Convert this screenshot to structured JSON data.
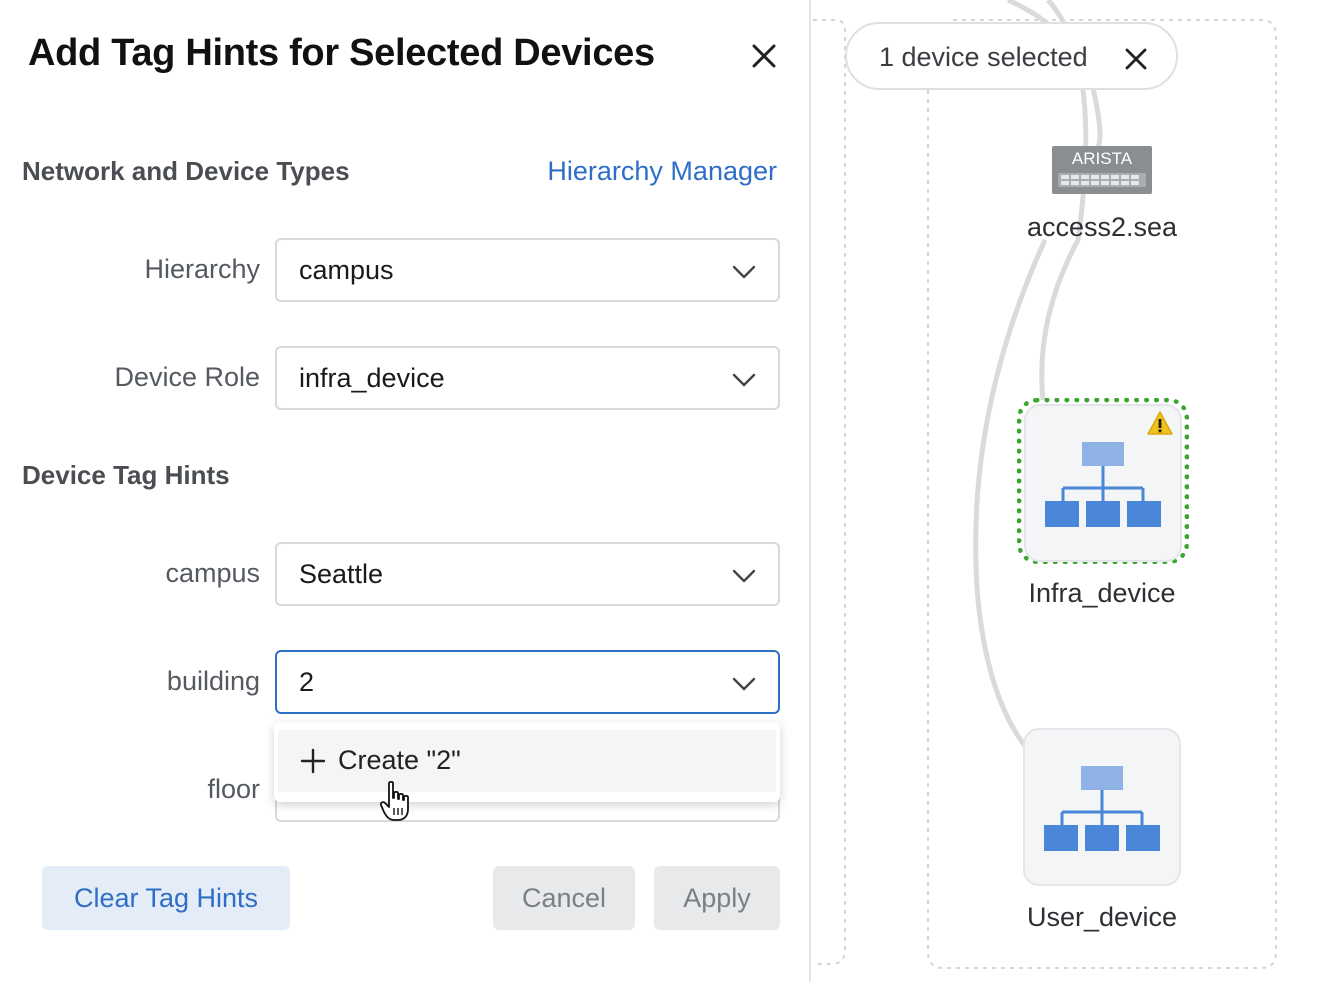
{
  "dialog": {
    "title": "Add Tag Hints for Selected Devices",
    "close_icon": "close-icon"
  },
  "network_section": {
    "title": "Network and Device Types",
    "link": "Hierarchy Manager",
    "fields": [
      {
        "label": "Hierarchy",
        "value": "campus"
      },
      {
        "label": "Device Role",
        "value": "infra_device"
      }
    ]
  },
  "tag_hints_section": {
    "title": "Device Tag Hints",
    "fields": [
      {
        "label": "campus",
        "value": "Seattle"
      },
      {
        "label": "building",
        "value": "2"
      },
      {
        "label": "floor",
        "value": ""
      }
    ]
  },
  "dropdown": {
    "option": "Create \"2\"",
    "icon": "plus-icon"
  },
  "buttons": {
    "clear": "Clear Tag Hints",
    "cancel": "Cancel",
    "apply": "Apply"
  },
  "canvas": {
    "selection_chip": "1 device selected",
    "nodes": [
      {
        "name": "access2.sea",
        "logo": "ARISTA",
        "icon": "arista-switch-icon"
      },
      {
        "name": "Infra_device",
        "icon": "hierarchy-icon",
        "selected": true,
        "warning": true
      },
      {
        "name": "User_device",
        "icon": "hierarchy-icon"
      }
    ],
    "colors": {
      "selection_border": "#3aa52e",
      "warning": "#f2c21b",
      "node_icon": "#4a87d8",
      "link": "#d9dadc",
      "accent": "#2e6ec6"
    }
  }
}
